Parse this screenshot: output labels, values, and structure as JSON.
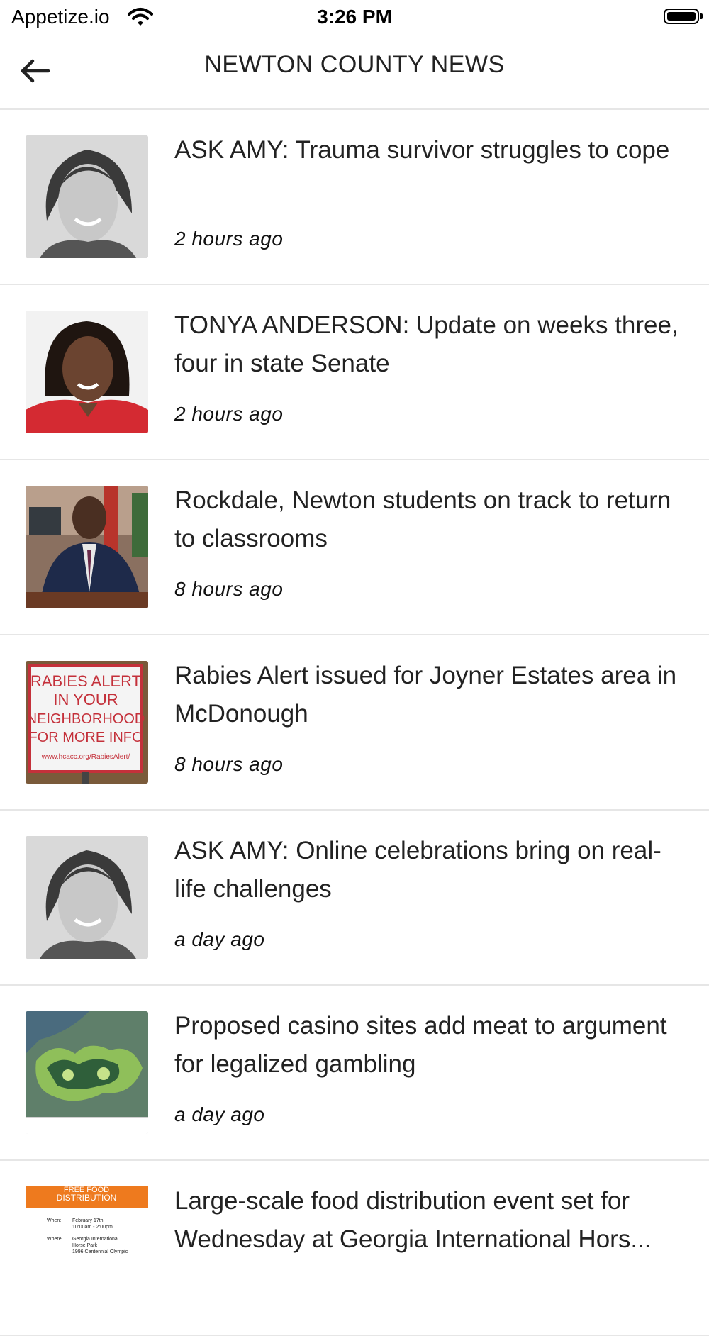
{
  "status_bar": {
    "carrier": "Appetize.io",
    "time": "3:26 PM"
  },
  "app_bar": {
    "title": "NEWTON COUNTY NEWS"
  },
  "articles": [
    {
      "headline": "ASK AMY: Trauma survivor struggles to cope",
      "time": "2 hours ago"
    },
    {
      "headline": "TONYA ANDERSON: Update on weeks three, four in state Senate",
      "time": "2 hours ago"
    },
    {
      "headline": "Rockdale, Newton students on track to return to classrooms",
      "time": "8 hours ago"
    },
    {
      "headline": "Rabies Alert issued for Joyner Estates area in McDonough",
      "time": "8 hours ago",
      "sign_lines": [
        "RABIES ALERT",
        "IN YOUR",
        "NEIGHBORHOOD",
        "FOR MORE INFO",
        "www.hcacc.org/RabiesAlert/"
      ]
    },
    {
      "headline": "ASK AMY: Online celebrations bring on real-life challenges",
      "time": "a day ago"
    },
    {
      "headline": "Proposed casino sites add meat to argument for legalized gambling",
      "time": "a day ago"
    },
    {
      "headline_line1": "Large-scale food distribution event set for",
      "headline_line2": "Wednesday at Georgia International Hors...",
      "flyer_title_1": "FREE FOOD",
      "flyer_title_2": "DISTRIBUTION",
      "flyer_when_label": "When:",
      "flyer_when_1": "February 17th",
      "flyer_when_2": "10:00am - 2:00pm",
      "flyer_where_label": "Where:",
      "flyer_where_1": "Georgia International",
      "flyer_where_2": "Horse Park",
      "flyer_where_3": "1996 Centennial Olympic"
    }
  ]
}
